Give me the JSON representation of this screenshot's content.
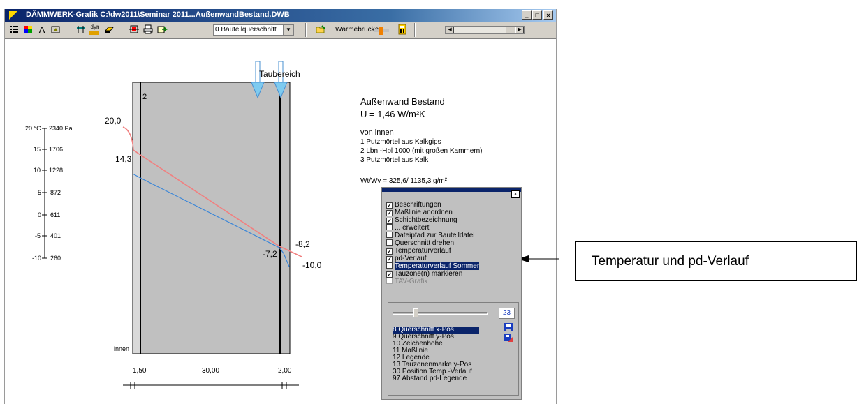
{
  "window": {
    "title": "DÄMMWERK-Grafik  C:\\dw2011\\Seminar 2011...AußenwandBestand.DWB",
    "minimize": "_",
    "maximize": "□",
    "close": "×"
  },
  "toolbar": {
    "icons": [
      "list-icon",
      "color-palette-icon",
      "font-icon",
      "edit-picture-icon",
      "dimension-icon",
      "dyn-icon",
      "layer-icon",
      "grid-icon",
      "print-icon",
      "export-icon"
    ],
    "font_label": "A",
    "dyn_label": "dyn",
    "select_value": "0 Bauteilquerschnitt",
    "waermebruecke_label": "Wärmebrücke"
  },
  "graphic": {
    "taubereich_label": "Taubereich",
    "layer_number": "2",
    "innen_label": "innen",
    "temp_labels": [
      "20,0",
      "14,3",
      "-7,2",
      "-8,2",
      "-10,0"
    ],
    "axis_ticks": [
      {
        "t": "20 °C",
        "p": "2340 Pa"
      },
      {
        "t": "15",
        "p": "1706"
      },
      {
        "t": "10",
        "p": "1228"
      },
      {
        "t": "5",
        "p": "872"
      },
      {
        "t": "0",
        "p": "611"
      },
      {
        "t": "-5",
        "p": "401"
      },
      {
        "t": "-10",
        "p": "260"
      }
    ],
    "dimensions": [
      "1,50",
      "30,00",
      "2,00"
    ],
    "colors": {
      "temperature": "#f08080",
      "pd": "#3a86d8",
      "wall": "#c0c0c0"
    }
  },
  "info": {
    "title": "Außenwand Bestand",
    "u_value": "U = 1,46 W/m²K",
    "von_innen": "von innen",
    "layers": [
      "1 Putzmörtel aus Kalkgips",
      "2 Lbn -Hbl 1000 (mit großen Kammern)",
      "3 Putzmörtel aus Kalk"
    ],
    "wtwv": "Wt/Wv  =  325,6/ 1135,3 g/m²"
  },
  "panel": {
    "close": "×",
    "options": [
      {
        "label": "Beschriftungen",
        "checked": true
      },
      {
        "label": "Maßlinie anordnen",
        "checked": true
      },
      {
        "label": "Schichtbezeichnung",
        "checked": true
      },
      {
        "label": "... erweitert",
        "checked": false
      },
      {
        "label": "Dateipfad zur Bauteildatei",
        "checked": false
      },
      {
        "label": "Querschnitt drehen",
        "checked": false
      },
      {
        "label": "Temperaturverlauf",
        "checked": true
      },
      {
        "label": "pd-Verlauf",
        "checked": true
      },
      {
        "label": "Temperaturverlauf Sommer",
        "checked": false
      },
      {
        "label": "Tauzone(n) markieren",
        "checked": true
      },
      {
        "label": "TAV-Grafik",
        "checked": false
      }
    ],
    "slider_value": "23",
    "list": [
      "8 Querschnitt x-Pos",
      "9 Querschnitt y-Pos",
      "10 Zeichenhöhe",
      "11 Maßlinie",
      "12 Legende",
      "13 Tauzonenmarke y-Pos",
      "30 Position Temp.-Verlauf",
      "97 Abstand pd-Legende"
    ]
  },
  "callout": {
    "text": "Temperatur und pd-Verlauf"
  }
}
